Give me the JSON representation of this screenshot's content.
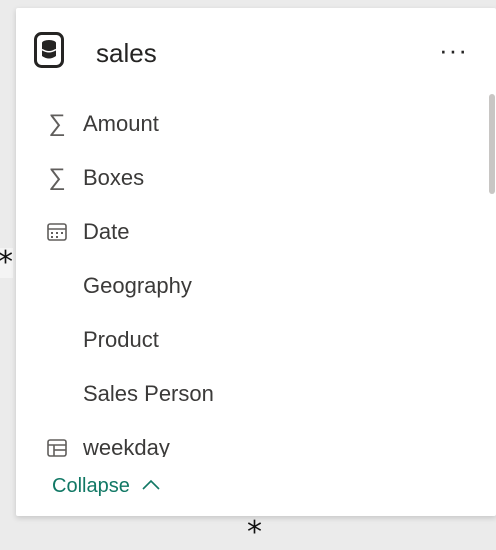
{
  "table": {
    "name": "sales",
    "more_label": "···",
    "icon": "database-icon"
  },
  "fields": [
    {
      "label": "Amount",
      "icon": "sigma-icon",
      "glyph": "∑"
    },
    {
      "label": "Boxes",
      "icon": "sigma-icon",
      "glyph": "∑"
    },
    {
      "label": "Date",
      "icon": "calendar-icon",
      "glyph": ""
    },
    {
      "label": "Geography",
      "icon": "",
      "glyph": ""
    },
    {
      "label": "Product",
      "icon": "",
      "glyph": ""
    },
    {
      "label": "Sales Person",
      "icon": "",
      "glyph": ""
    },
    {
      "label": "weekday",
      "icon": "hierarchy-table-icon",
      "glyph": ""
    }
  ],
  "collapse_label": "Collapse",
  "resize_handles": {
    "left": "*",
    "bottom": "*"
  },
  "colors": {
    "accent": "#117865",
    "background": "#ebebeb",
    "card": "#ffffff",
    "text": "#252423"
  }
}
